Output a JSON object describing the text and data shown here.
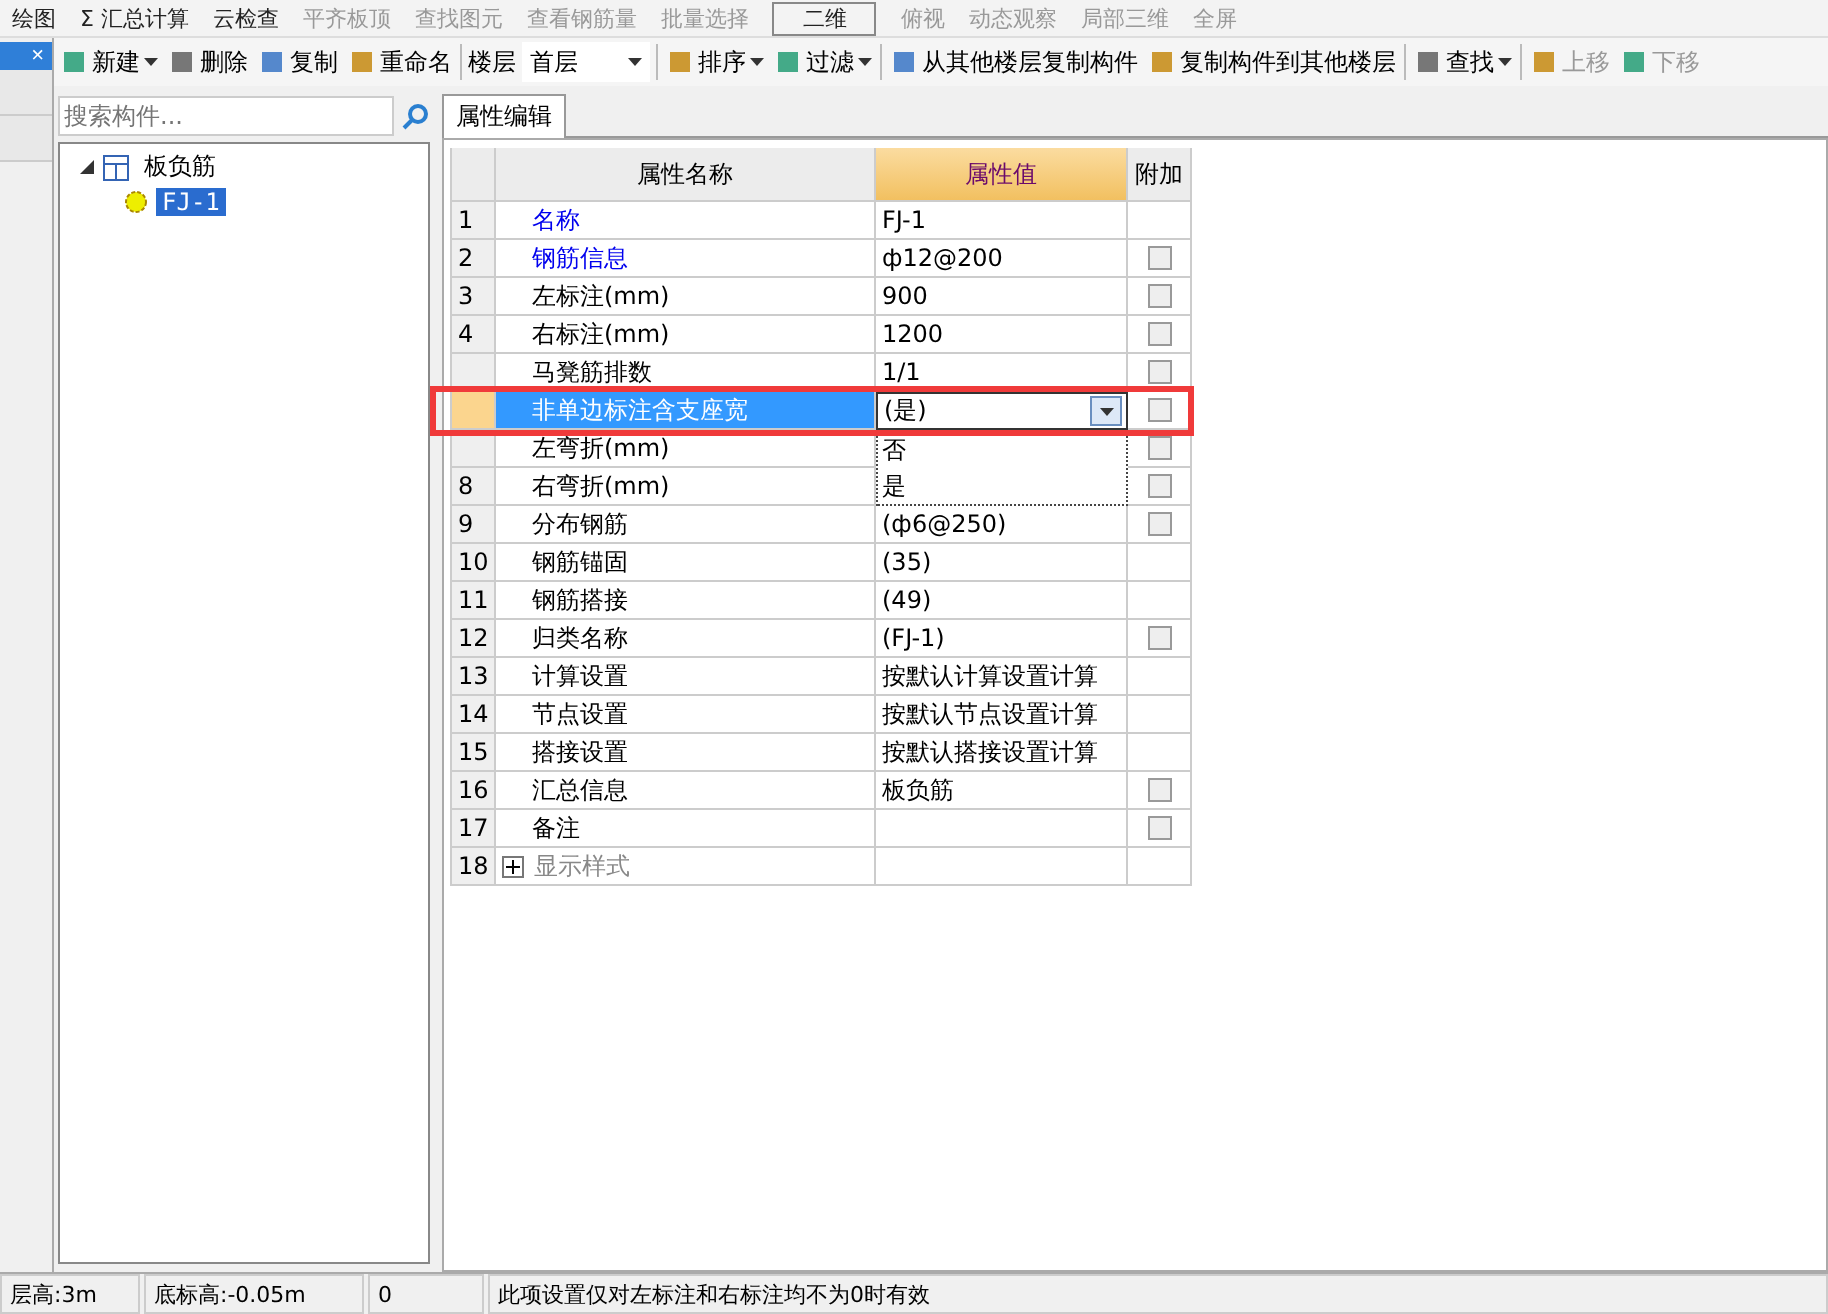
{
  "top_toolbar": [
    {
      "label": "绘图"
    },
    {
      "label": "Σ 汇总计算"
    },
    {
      "label": "云检查"
    },
    {
      "label": "平齐板顶",
      "disabled": true
    },
    {
      "label": "查找图元",
      "disabled": true
    },
    {
      "label": "查看钢筋量",
      "disabled": true
    },
    {
      "label": "批量选择",
      "disabled": true
    },
    {
      "label": "二维",
      "kind": "dropdown"
    },
    {
      "label": "俯视",
      "disabled": true
    },
    {
      "label": "动态观察",
      "disabled": true
    },
    {
      "label": "局部三维",
      "disabled": true
    },
    {
      "label": "全屏",
      "disabled": true
    }
  ],
  "left_strip": {
    "close": "×"
  },
  "toolbar": [
    {
      "kind": "button",
      "label": "新建",
      "menu": true
    },
    {
      "kind": "button",
      "label": "删除"
    },
    {
      "kind": "button",
      "label": "复制"
    },
    {
      "kind": "button",
      "label": "重命名"
    },
    {
      "kind": "separator"
    },
    {
      "kind": "floor",
      "label": "楼层",
      "value": "首层"
    },
    {
      "kind": "separator"
    },
    {
      "kind": "button",
      "label": "排序",
      "menu": true
    },
    {
      "kind": "button",
      "label": "过滤",
      "menu": true
    },
    {
      "kind": "separator"
    },
    {
      "kind": "button",
      "label": "从其他楼层复制构件"
    },
    {
      "kind": "button",
      "label": "复制构件到其他楼层"
    },
    {
      "kind": "separator"
    },
    {
      "kind": "button",
      "label": "查找",
      "menu": true
    },
    {
      "kind": "separator"
    },
    {
      "kind": "button",
      "label": "上移",
      "disabled": true
    },
    {
      "kind": "button",
      "label": "下移",
      "disabled": true
    }
  ],
  "search": {
    "placeholder": "搜索构件..."
  },
  "tree": [
    {
      "label": "板负筋",
      "expanded": true,
      "selected": false,
      "children": [
        {
          "label": "FJ-1",
          "selected": true
        }
      ]
    }
  ],
  "tabs": [
    {
      "label": "属性编辑",
      "selected": true
    }
  ],
  "table": {
    "columns": [
      "属性名称",
      "属性值",
      "附加"
    ],
    "rows": [
      {
        "index": "1",
        "name": "名称",
        "kind": "public",
        "value": "FJ-1",
        "selected": false
      },
      {
        "index": "2",
        "name": "钢筋信息",
        "kind": "public",
        "value": "ф12@200",
        "checked": false,
        "selected": false
      },
      {
        "index": "3",
        "name": "左标注(mm)",
        "kind": "private",
        "value": "900",
        "checked": false,
        "selected": false
      },
      {
        "index": "4",
        "name": "右标注(mm)",
        "kind": "private",
        "value": "1200",
        "checked": false,
        "selected": false
      },
      {
        "index": "",
        "name": "马凳筋排数",
        "kind": "private",
        "value": "1/1",
        "checked": false,
        "selected": false
      },
      {
        "index": "",
        "name": "非单边标注含支座宽",
        "kind": "private",
        "value": "(是)",
        "checked": false,
        "selected": true,
        "editing": true,
        "options": [
          "否",
          "是"
        ]
      },
      {
        "index": "",
        "name": "左弯折(mm)",
        "kind": "private",
        "value": "",
        "checked": false,
        "selected": false
      },
      {
        "index": "8",
        "name": "右弯折(mm)",
        "kind": "private",
        "value": "",
        "checked": false,
        "selected": false
      },
      {
        "index": "9",
        "name": "分布钢筋",
        "kind": "private",
        "value": "(ф6@250)",
        "checked": false,
        "selected": false
      },
      {
        "index": "10",
        "name": "钢筋锚固",
        "kind": "private",
        "value": "(35)",
        "selected": false
      },
      {
        "index": "11",
        "name": "钢筋搭接",
        "kind": "private",
        "value": "(49)",
        "selected": false
      },
      {
        "index": "12",
        "name": "归类名称",
        "kind": "private",
        "value": "(FJ-1)",
        "checked": false,
        "selected": false
      },
      {
        "index": "13",
        "name": "计算设置",
        "kind": "private",
        "value": "按默认计算设置计算",
        "selected": false
      },
      {
        "index": "14",
        "name": "节点设置",
        "kind": "private",
        "value": "按默认节点设置计算",
        "selected": false
      },
      {
        "index": "15",
        "name": "搭接设置",
        "kind": "private",
        "value": "按默认搭接设置计算",
        "selected": false
      },
      {
        "index": "16",
        "name": "汇总信息",
        "kind": "private",
        "value": "板负筋",
        "checked": false,
        "selected": false
      },
      {
        "index": "17",
        "name": "备注",
        "kind": "private",
        "value": "",
        "checked": false,
        "selected": false
      },
      {
        "index": "18",
        "name": "显示样式",
        "kind": "group",
        "expanded": false,
        "value": "",
        "selected": false
      }
    ]
  },
  "status_bar": [
    "层高:3m",
    "底标高:-0.05m",
    "0",
    "此项设置仅对左标注和右标注均不为0时有效"
  ]
}
